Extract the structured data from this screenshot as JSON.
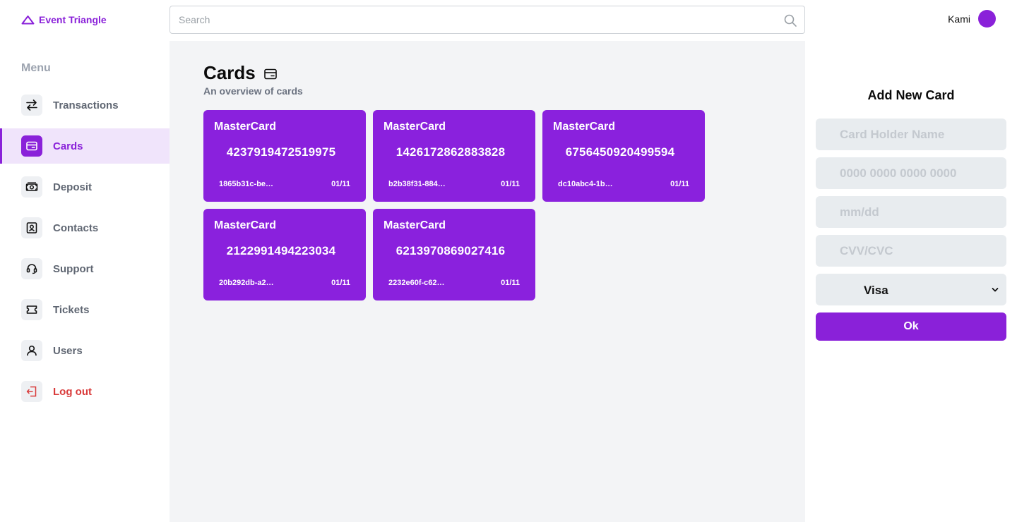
{
  "brand": {
    "name": "Event Triangle",
    "icon": "triangle-icon",
    "color": "#8a21d9"
  },
  "search": {
    "placeholder": "Search",
    "value": "",
    "icon": "search-icon"
  },
  "user": {
    "name": "Kami",
    "avatar_color": "#8a21d9"
  },
  "sidebar": {
    "title": "Menu",
    "items": [
      {
        "label": "Transactions",
        "icon": "arrows-swap-icon"
      },
      {
        "label": "Cards",
        "icon": "card-icon",
        "active": true
      },
      {
        "label": "Deposit",
        "icon": "money-icon"
      },
      {
        "label": "Contacts",
        "icon": "contact-book-icon"
      },
      {
        "label": "Support",
        "icon": "headset-icon"
      },
      {
        "label": "Tickets",
        "icon": "ticket-icon"
      },
      {
        "label": "Users",
        "icon": "user-icon"
      },
      {
        "label": "Log out",
        "icon": "logout-icon",
        "danger": true
      }
    ]
  },
  "main": {
    "title": "Cards",
    "title_icon": "card-icon",
    "subtitle": "An overview of cards",
    "cards": [
      {
        "brand": "MasterCard",
        "number": "4237919472519975",
        "id": "1865b31c-be…",
        "expiry": "01/11"
      },
      {
        "brand": "MasterCard",
        "number": "1426172862883828",
        "id": "b2b38f31-884…",
        "expiry": "01/11"
      },
      {
        "brand": "MasterCard",
        "number": "6756450920499594",
        "id": "dc10abc4-1b…",
        "expiry": "01/11"
      },
      {
        "brand": "MasterCard",
        "number": "2122991494223034",
        "id": "20b292db-a2…",
        "expiry": "01/11"
      },
      {
        "brand": "MasterCard",
        "number": "6213970869027416",
        "id": "2232e60f-c62…",
        "expiry": "01/11"
      }
    ]
  },
  "form": {
    "title": "Add New Card",
    "holder_placeholder": "Card Holder Name",
    "number_placeholder": "0000 0000 0000 0000",
    "expiry_placeholder": "mm/dd",
    "cvv_placeholder": "CVV/CVC",
    "card_type": "Visa",
    "submit_label": "Ok"
  },
  "colors": {
    "accent": "#8a21d9",
    "card_bg": "#8a21dd",
    "danger": "#d93a3a",
    "main_bg": "#f3f4f6"
  }
}
